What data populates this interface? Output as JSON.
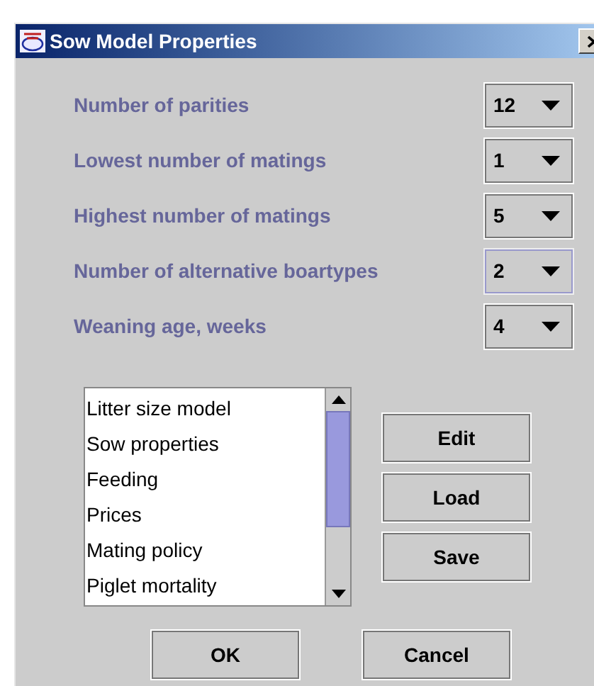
{
  "window": {
    "title": "Sow Model Properties"
  },
  "settings": [
    {
      "label": "Number of parities",
      "value": "12",
      "focused": false
    },
    {
      "label": "Lowest number of matings",
      "value": "1",
      "focused": false
    },
    {
      "label": "Highest number of matings",
      "value": "5",
      "focused": false
    },
    {
      "label": "Number of alternative boartypes",
      "value": "2",
      "focused": true
    },
    {
      "label": "Weaning age, weeks",
      "value": "4",
      "focused": false
    }
  ],
  "list_items": [
    "Litter size model",
    "Sow properties",
    "Feeding",
    "Prices",
    "Mating policy",
    "Piglet mortality"
  ],
  "side_buttons": [
    "Edit",
    "Load",
    "Save"
  ],
  "buttons": [
    "OK",
    "Cancel"
  ]
}
